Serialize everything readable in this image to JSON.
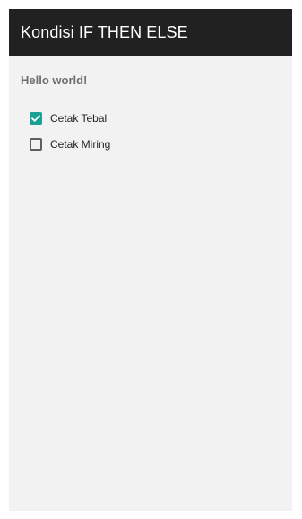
{
  "app": {
    "title": "Kondisi IF THEN ELSE"
  },
  "main": {
    "greeting": "Hello world!",
    "checkboxes": [
      {
        "label": "Cetak Tebal",
        "checked": true,
        "icon": "checkmark-icon"
      },
      {
        "label": "Cetak Miring",
        "checked": false,
        "icon": "empty-checkbox-icon"
      }
    ]
  },
  "colors": {
    "action_bar": "#212121",
    "accent": "#1aa095",
    "background": "#f2f2f2"
  }
}
